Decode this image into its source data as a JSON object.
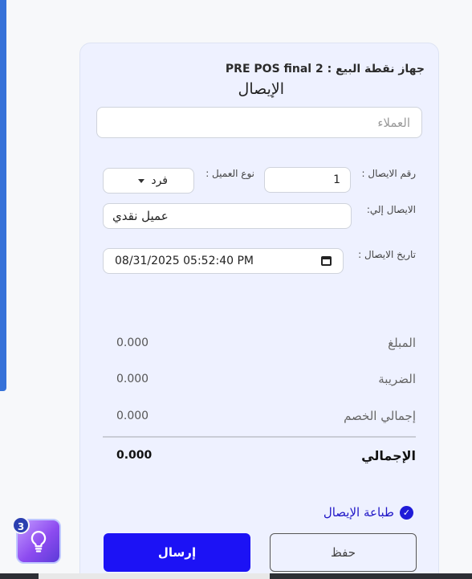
{
  "header": {
    "device_label": "جهاز نقطة البيع : PRE POS final 2",
    "title": "الإيصال"
  },
  "customers": {
    "placeholder": "العملاء",
    "value": ""
  },
  "form": {
    "receipt_number_label": "رقم الايصال :",
    "receipt_number_value": "1",
    "customer_type_label": "نوع العميل :",
    "customer_type_value": "فرد",
    "receipt_to_label": "الايصال إلي:",
    "receipt_to_value": "عميل نقدي",
    "receipt_date_label": "تاريخ الايصال :",
    "receipt_date_value": "08/31/2025 05:52:40 PM"
  },
  "summary": {
    "amount_label": "المبلغ",
    "amount_value": "0.000",
    "tax_label": "الضريبة",
    "tax_value": "0.000",
    "discount_label": "إجمالي الخصم",
    "discount_value": "0.000",
    "total_label": "الإجمالي",
    "total_value": "0.000"
  },
  "options": {
    "print_receipt_label": "طباعة الإيصال",
    "print_receipt_checked": true
  },
  "actions": {
    "send_label": "إرسال",
    "save_label": "حفظ"
  },
  "help": {
    "badge_count": "3",
    "icon": "lightbulb-icon"
  },
  "colors": {
    "primary": "#1c12f5",
    "accent_link": "#2017c7",
    "panel_bg": "#eef1ff",
    "side_accent": "#3672d9"
  }
}
